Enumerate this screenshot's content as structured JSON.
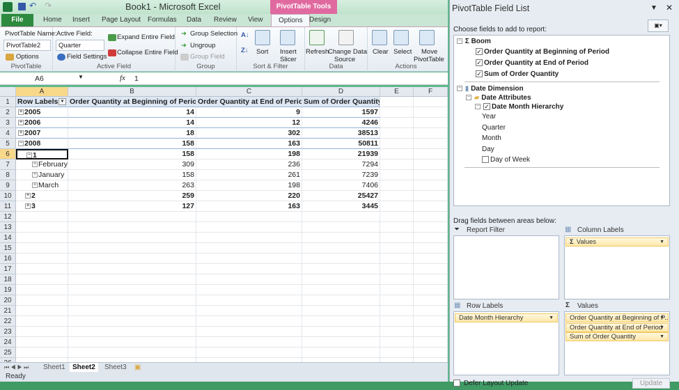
{
  "window": {
    "title": "Book1 - Microsoft Excel",
    "context_tab": "PivotTable Tools"
  },
  "tabs": [
    "File",
    "Home",
    "Insert",
    "Page Layout",
    "Formulas",
    "Data",
    "Review",
    "View",
    "Options",
    "Design"
  ],
  "active_tab": "Options",
  "ribbon": {
    "pivottable": {
      "name_label": "PivotTable Name:",
      "name_value": "PivotTable2",
      "options": "Options",
      "group": "PivotTable"
    },
    "active_field": {
      "label": "Active Field:",
      "value": "Quarter",
      "field_settings": "Field Settings",
      "expand": "Expand Entire Field",
      "collapse": "Collapse Entire Field",
      "group": "Active Field"
    },
    "group": {
      "group_selection": "Group Selection",
      "ungroup": "Ungroup",
      "group_field": "Group Field",
      "group": "Group"
    },
    "sort": {
      "sort": "Sort",
      "insert": "Insert",
      "slicer": "Slicer",
      "group": "Sort & Filter"
    },
    "data": {
      "refresh": "Refresh",
      "change": "Change Data",
      "source": "Source",
      "group": "Data"
    },
    "actions": {
      "clear": "Clear",
      "select": "Select",
      "move": "Move",
      "pivottable": "PivotTable",
      "group": "Actions"
    }
  },
  "formula_bar": {
    "name_box": "A6",
    "fx": "fx",
    "value": "1"
  },
  "grid": {
    "columns": [
      "A",
      "B",
      "C",
      "D",
      "E",
      "F"
    ],
    "row_numbers": [
      "1",
      "2",
      "3",
      "4",
      "5",
      "6",
      "7",
      "8",
      "9",
      "10",
      "11",
      "12",
      "13",
      "14",
      "15",
      "16",
      "17",
      "18",
      "19",
      "20",
      "21",
      "22",
      "23",
      "24",
      "25",
      "26"
    ],
    "header": [
      "Row Labels",
      "Order Quantity at Beginning of Period",
      "Order Quantity at End of Period",
      "Sum of Order Quantity"
    ],
    "rows": [
      {
        "label": "2005",
        "expander": "+",
        "indent": 0,
        "bold": true,
        "values": [
          "14",
          "9",
          "1597"
        ]
      },
      {
        "label": "2006",
        "expander": "+",
        "indent": 0,
        "bold": true,
        "values": [
          "14",
          "12",
          "4246"
        ]
      },
      {
        "label": "2007",
        "expander": "+",
        "indent": 0,
        "bold": true,
        "values": [
          "18",
          "302",
          "38513"
        ]
      },
      {
        "label": "2008",
        "expander": "-",
        "indent": 0,
        "bold": true,
        "values": [
          "158",
          "163",
          "50811"
        ]
      },
      {
        "label": "1",
        "expander": "-",
        "indent": 1,
        "bold": true,
        "values": [
          "158",
          "198",
          "21939"
        ]
      },
      {
        "label": "February",
        "expander": "+",
        "indent": 2,
        "bold": false,
        "values": [
          "309",
          "236",
          "7294"
        ]
      },
      {
        "label": "January",
        "expander": "+",
        "indent": 2,
        "bold": false,
        "values": [
          "158",
          "261",
          "7239"
        ]
      },
      {
        "label": "March",
        "expander": "+",
        "indent": 2,
        "bold": false,
        "values": [
          "263",
          "198",
          "7406"
        ]
      },
      {
        "label": "2",
        "expander": "+",
        "indent": 1,
        "bold": true,
        "values": [
          "259",
          "220",
          "25427"
        ]
      },
      {
        "label": "3",
        "expander": "+",
        "indent": 1,
        "bold": true,
        "values": [
          "127",
          "163",
          "3445"
        ]
      }
    ],
    "selected_cell": "A6"
  },
  "sheets": [
    "Sheet1",
    "Sheet2",
    "Sheet3"
  ],
  "active_sheet": "Sheet2",
  "status": "Ready",
  "field_list": {
    "title": "PivotTable Field List",
    "choose_label": "Choose fields to add to report:",
    "tree": {
      "measure_group": "Boom",
      "measures": [
        "Order Quantity at Beginning of Period",
        "Order Quantity at End of Period",
        "Sum of Order Quantity"
      ],
      "dimension": "Date Dimension",
      "folder": "Date Attributes",
      "hierarchy": "Date Month Hierarchy",
      "levels": [
        "Year",
        "Quarter",
        "Month",
        "Day"
      ],
      "unchecked": "Day of Week"
    },
    "drag_label": "Drag fields between areas below:",
    "areas": {
      "report_filter": "Report Filter",
      "column_labels": "Column Labels",
      "row_labels": "Row Labels",
      "values": "Values"
    },
    "column_items": [
      "Values"
    ],
    "row_items": [
      "Date Month Hierarchy"
    ],
    "value_items": [
      "Order Quantity at Beginning of P...",
      "Order Quantity at End of Period",
      "Sum of Order Quantity"
    ],
    "defer": "Defer Layout Update",
    "update": "Update"
  }
}
